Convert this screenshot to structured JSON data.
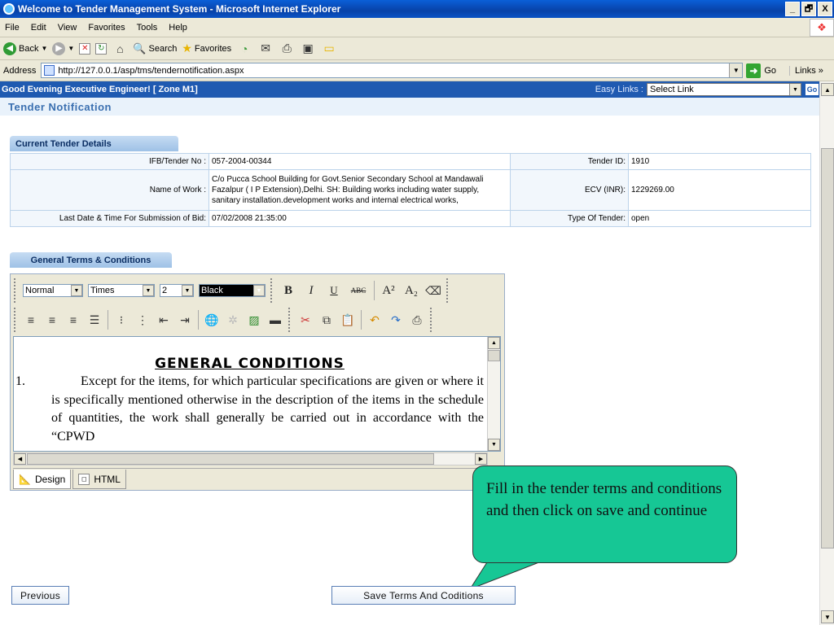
{
  "window": {
    "title": "Welcome to Tender Management System - Microsoft Internet Explorer",
    "minimize": "_",
    "restore": "🗗",
    "close": "X"
  },
  "menu": [
    "File",
    "Edit",
    "View",
    "Favorites",
    "Tools",
    "Help"
  ],
  "toolbar": {
    "back": "Back",
    "search": "Search",
    "favorites": "Favorites"
  },
  "address": {
    "label": "Address",
    "url": "http://127.0.0.1/asp/tms/tendernotification.aspx",
    "go": "Go",
    "links": "Links"
  },
  "greeting": {
    "text": "Good Evening Executive Engineer!   [ Zone M1]",
    "easy_links_label": "Easy Links :",
    "easy_links_value": "Select Link",
    "go": "Go"
  },
  "page_title": "Tender  Notification",
  "current_tender": {
    "section_label": "Current Tender Details",
    "ifb_label": "IFB/Tender No :",
    "ifb_value": "057-2004-00344",
    "tender_id_label": "Tender ID:",
    "tender_id_value": "1910",
    "work_label": "Name of Work :",
    "work_value": "C/o Pucca School Building for Govt.Senior Secondary School at Mandawali Fazalpur ( I P Extension),Delhi. SH: Building works including water supply, sanitary installation.development works and internal electrical works,",
    "ecv_label": "ECV (INR):",
    "ecv_value": "1229269.00",
    "last_date_label": "Last Date & Time For Submission of Bid:",
    "last_date_value": "07/02/2008 21:35:00",
    "type_label": "Type Of Tender:",
    "type_value": "open"
  },
  "terms": {
    "section_label": "General Terms & Conditions",
    "style_value": "Normal",
    "font_value": "Times",
    "size_value": "2",
    "color_value": "Black",
    "doc_heading": "GENERAL CONDITIONS",
    "item_number": "1.",
    "item_text": "Except for the items, for which particular specifications are given or where it is specifically mentioned otherwise in the description of the items in the schedule of quantities, the work shall generally be carried out in accordance with the “CPWD",
    "tab_design": "Design",
    "tab_html": "HTML"
  },
  "format_buttons": {
    "bold": "B",
    "italic": "I",
    "underline": "U",
    "strike": "ABC",
    "superscript": "A²",
    "subscript": "A₂"
  },
  "callout": "Fill in the tender terms and conditions and then click on save and continue",
  "buttons": {
    "previous": "Previous",
    "save": "Save Terms And Coditions"
  }
}
